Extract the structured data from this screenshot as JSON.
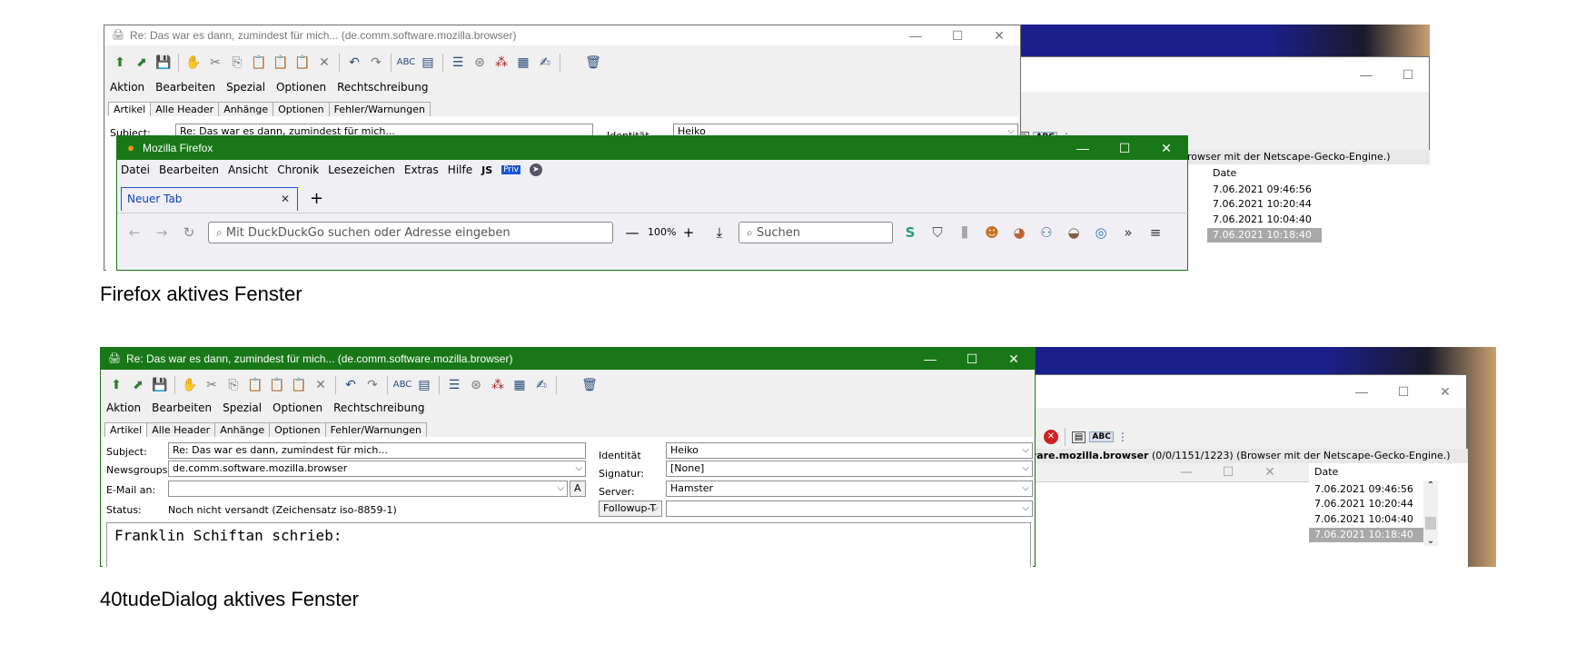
{
  "mail_window": {
    "title": "Re: Das war es dann, zumindest für mich... (de.comm.software.mozilla.browser)",
    "menu": [
      "Aktion",
      "Bearbeiten",
      "Spezial",
      "Optionen",
      "Rechtschreibung"
    ],
    "tabs": [
      "Artikel",
      "Alle Header",
      "Anhänge",
      "Optionen",
      "Fehler/Warnungen"
    ],
    "subject_label": "Subject:",
    "subject_value": "Re: Das war es dann, zumindest für mich...",
    "newsgroups_label": "Newsgroups:",
    "newsgroups_value": "de.comm.software.mozilla.browser",
    "email_label": "E-Mail an:",
    "email_btn": "A",
    "status_label": "Status:",
    "status_value": "Noch nicht versandt (Zeichensatz iso-8859-1)",
    "identity_label": "Identität",
    "identity_value": "Heiko",
    "signature_label": "Signatur:",
    "signature_value": "[None]",
    "server_label": "Server:",
    "server_value": "Hamster",
    "followup_label": "Followup-T",
    "body_text": "Franklin Schiftan schrieb:"
  },
  "firefox_window": {
    "title": "Mozilla Firefox",
    "menu": [
      "Datei",
      "Bearbeiten",
      "Ansicht",
      "Chronik",
      "Lesezeichen",
      "Extras",
      "Hilfe"
    ],
    "js_label": "JS",
    "priv_label": "Priv",
    "tab_label": "Neuer Tab",
    "url_placeholder": "Mit DuckDuckGo suchen oder Adresse eingeben",
    "zoom": "100%",
    "search_placeholder": "Suchen"
  },
  "bg_window": {
    "group_bold": "ftware.mozilla.browser",
    "group_rest": " (0/0/1151/1223) (Browser mit der Netscape-Gecko-Engine.)",
    "abc": "ABC",
    "date_header": "Date",
    "dates": [
      "7.06.2021 09:46:56",
      "7.06.2021 10:20:44",
      "7.06.2021 10:04:40",
      "7.06.2021 10:18:40"
    ]
  },
  "captions": {
    "first": "Firefox aktives Fenster",
    "second": "40tudeDialog aktives Fenster"
  },
  "colors": {
    "active_title": "#187818",
    "desktop": "#1b1f8c"
  },
  "icons": {
    "min": "—",
    "max": "☐",
    "close": "✕"
  }
}
